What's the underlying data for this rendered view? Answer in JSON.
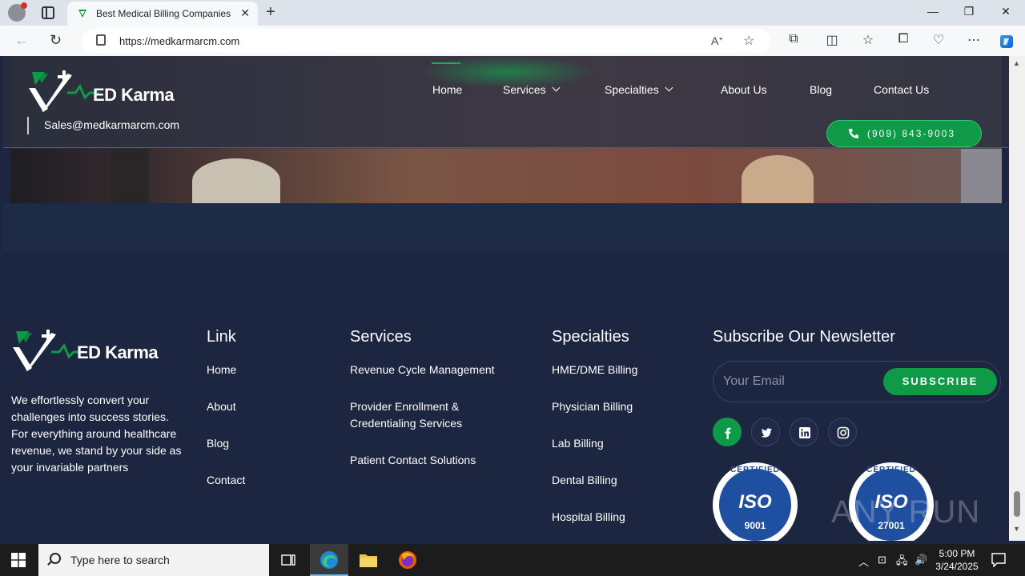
{
  "browser": {
    "tab_title": "Best Medical Billing Companies in",
    "url": "https://medkarmarcm.com",
    "new_tab": "+",
    "close_tab": "✕",
    "win_minimize": "—",
    "win_restore": "❐",
    "win_close": "✕"
  },
  "header": {
    "brand": "ED Karma",
    "email": "Sales@medkarmarcm.com",
    "nav": [
      {
        "label": "Home"
      },
      {
        "label": "Services"
      },
      {
        "label": "Specialties"
      },
      {
        "label": "About Us"
      },
      {
        "label": "Blog"
      },
      {
        "label": "Contact Us"
      }
    ],
    "phone": "(909) 843-9003"
  },
  "footer": {
    "brand": "ED Karma",
    "about": "We effortlessly convert your challenges into success stories. For everything around healthcare revenue, we stand by your side as your invariable partners",
    "link_heading": "Link",
    "links": [
      "Home",
      "About",
      "Blog",
      "Contact"
    ],
    "services_heading": "Services",
    "services": [
      "Revenue Cycle Management",
      "Provider Enrollment & Credentialing Services",
      "Patient Contact Solutions"
    ],
    "specialties_heading": "Specialties",
    "specialties": [
      "HME/DME Billing",
      "Physician Billing",
      "Lab Billing",
      "Dental Billing",
      "Hospital Billing"
    ],
    "newsletter_heading": "Subscribe Our Newsletter",
    "email_placeholder": "Your Email",
    "subscribe_label": "SUBSCRIBE",
    "socials": [
      "facebook-icon",
      "twitter-icon",
      "linkedin-icon",
      "instagram-icon"
    ],
    "iso": [
      {
        "top": "CERTIFIED",
        "word": "ISO",
        "num": "9001"
      },
      {
        "top": "CERTIFIED",
        "word": "ISO",
        "num": "27001"
      }
    ],
    "watermark": "ANY RUN"
  },
  "taskbar": {
    "search_placeholder": "Type here to search",
    "time": "5:00 PM",
    "date": "3/24/2025"
  },
  "colors": {
    "accent_green": "#0e9a46",
    "page_bg": "#1c2640"
  }
}
